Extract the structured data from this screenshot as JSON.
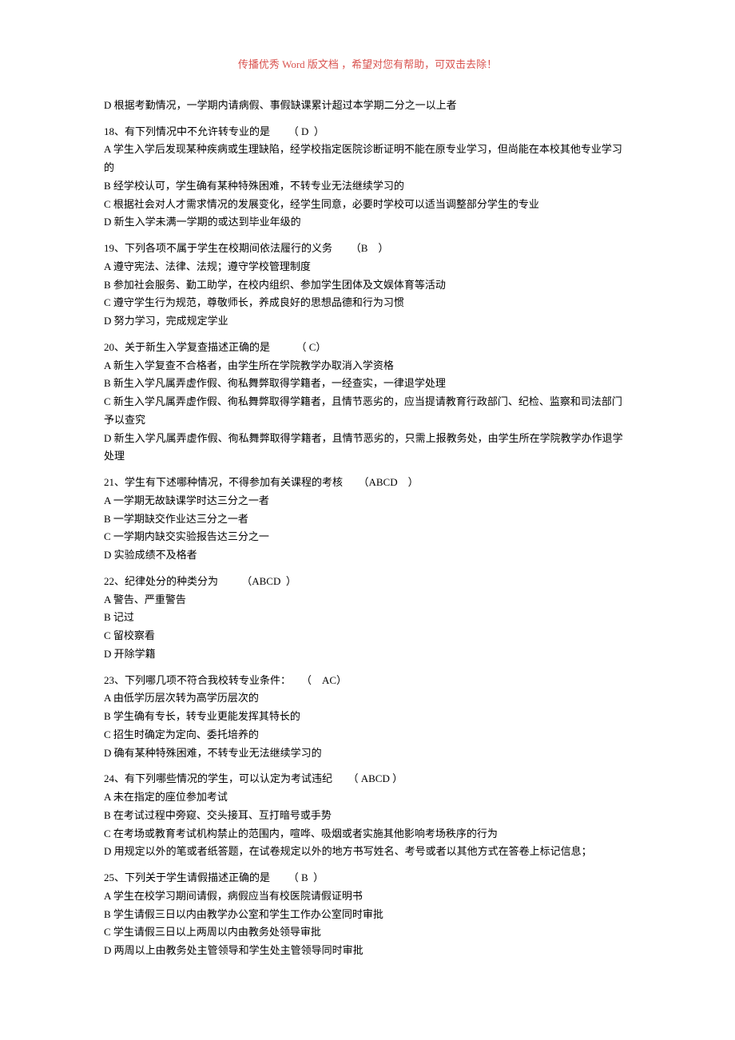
{
  "header": "传播优秀 Word 版文档 ，希望对您有帮助，可双击去除！",
  "lines": [
    "D 根据考勤情况，一学期内请病假、事假缺课累计超过本学期二分之一以上者",
    "",
    "18、有下列情况中不允许转专业的是       （ D  ）",
    "A 学生入学后发现某种疾病或生理缺陷，经学校指定医院诊断证明不能在原专业学习，但尚能在本校其他专业学习的",
    "B 经学校认可，学生确有某种特殊困难，不转专业无法继续学习的",
    "C 根据社会对人才需求情况的发展变化，经学生同意，必要时学校可以适当调整部分学生的专业",
    "D 新生入学未满一学期的或达到毕业年级的",
    "",
    "19、下列各项不属于学生在校期间依法履行的义务       （B    ）",
    "A 遵守宪法、法律、法规；遵守学校管理制度",
    "B 参加社会服务、勤工助学，在校内组织、参加学生团体及文娱体育等活动",
    "C 遵守学生行为规范，尊敬师长，养成良好的思想品德和行为习惯",
    "D 努力学习，完成规定学业",
    "",
    "20、关于新生入学复查描述正确的是          （ C）",
    "A 新生入学复查不合格者，由学生所在学院教学办取消入学资格",
    "B 新生入学凡属弄虚作假、徇私舞弊取得学籍者，一经查实，一律退学处理",
    "C 新生入学凡属弄虚作假、徇私舞弊取得学籍者，且情节恶劣的，应当提请教育行政部门、纪检、监察和司法部门予以查究",
    "D 新生入学凡属弄虚作假、徇私舞弊取得学籍者，且情节恶劣的，只需上报教务处，由学生所在学院教学办作退学处理",
    "",
    "21、学生有下述哪种情况，不得参加有关课程的考核      （ABCD    ）",
    "A 一学期无故缺课学时达三分之一者",
    "B 一学期缺交作业达三分之一者",
    "C 一学期内缺交实验报告达三分之一",
    "D 实验成绩不及格者",
    "",
    "22、纪律处分的种类分为         （ABCD  ）",
    "A 警告、严重警告",
    "B 记过",
    "C 留校察看",
    "D 开除学籍",
    "",
    "23、下列哪几项不符合我校转专业条件：    （    AC）",
    "A 由低学历层次转为高学历层次的",
    "B 学生确有专长，转专业更能发挥其特长的",
    "C 招生时确定为定向、委托培养的",
    "D 确有某种特殊困难，不转专业无法继续学习的",
    "",
    "24、有下列哪些情况的学生，可以认定为考试违纪      （ ABCD ）",
    "A 未在指定的座位参加考试",
    "B 在考试过程中旁窥、交头接耳、互打暗号或手势",
    "C 在考场或教育考试机构禁止的范围内，喧哗、吸烟或者实施其他影响考场秩序的行为",
    "D 用规定以外的笔或者纸答题，在试卷规定以外的地方书写姓名、考号或者以其他方式在答卷上标记信息；",
    "",
    "25、下列关于学生请假描述正确的是       （ B  ）",
    "A 学生在校学习期间请假，病假应当有校医院请假证明书",
    "B 学生请假三日以内由教学办公室和学生工作办公室同时审批",
    "C 学生请假三日以上两周以内由教务处领导审批",
    "D 两周以上由教务处主管领导和学生处主管领导同时审批"
  ]
}
